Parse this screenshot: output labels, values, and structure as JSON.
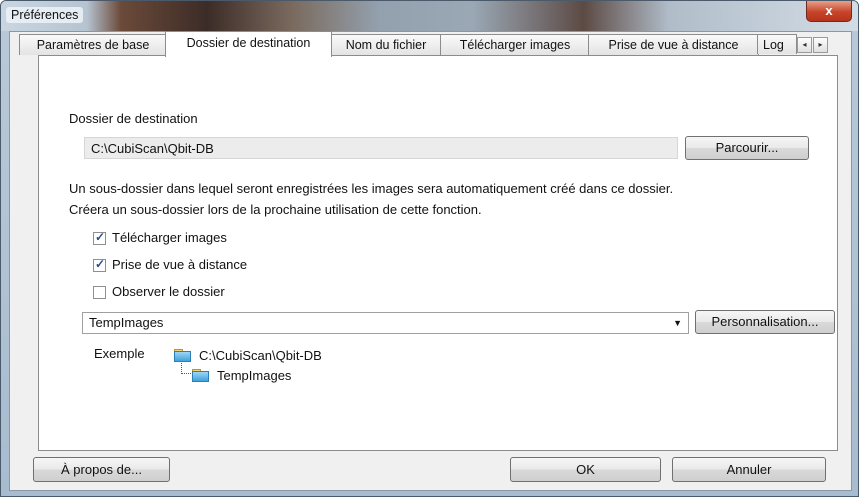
{
  "window": {
    "title": "Préférences",
    "close_glyph": "x"
  },
  "tabs": [
    {
      "label": "Paramètres de base",
      "active": false
    },
    {
      "label": "Dossier de destination",
      "active": true
    },
    {
      "label": "Nom du fichier",
      "active": false
    },
    {
      "label": "Télécharger images",
      "active": false
    },
    {
      "label": "Prise de vue à distance",
      "active": false
    },
    {
      "label": "Log",
      "active": false
    }
  ],
  "tab_scroll": {
    "left_icon": "scroll-left-icon",
    "right_icon": "scroll-right-icon",
    "left_glyph": "◂",
    "right_glyph": "▸"
  },
  "destination": {
    "label": "Dossier de destination",
    "path": "C:\\CubiScan\\Qbit-DB",
    "browse_button": "Parcourir..."
  },
  "info": {
    "line1": "Un sous-dossier dans lequel seront enregistrées les images sera automatiquement créé dans ce dossier.",
    "line2": "Créera un sous-dossier lors de la prochaine utilisation de cette fonction."
  },
  "checkboxes": [
    {
      "label": "Télécharger images",
      "checked": true
    },
    {
      "label": "Prise de vue à distance",
      "checked": true
    },
    {
      "label": "Observer le dossier",
      "checked": false
    }
  ],
  "subfolder": {
    "selected": "TempImages",
    "custom_button": "Personnalisation..."
  },
  "example": {
    "label": "Exemple",
    "root": "C:\\CubiScan\\Qbit-DB",
    "child": "TempImages"
  },
  "footer": {
    "about_button": "À propos de...",
    "ok_button": "OK",
    "cancel_button": "Annuler"
  },
  "colors": {
    "checkmark": "#2a4d91",
    "close_button": "#c6452a",
    "folder": "#3ea3dc"
  }
}
